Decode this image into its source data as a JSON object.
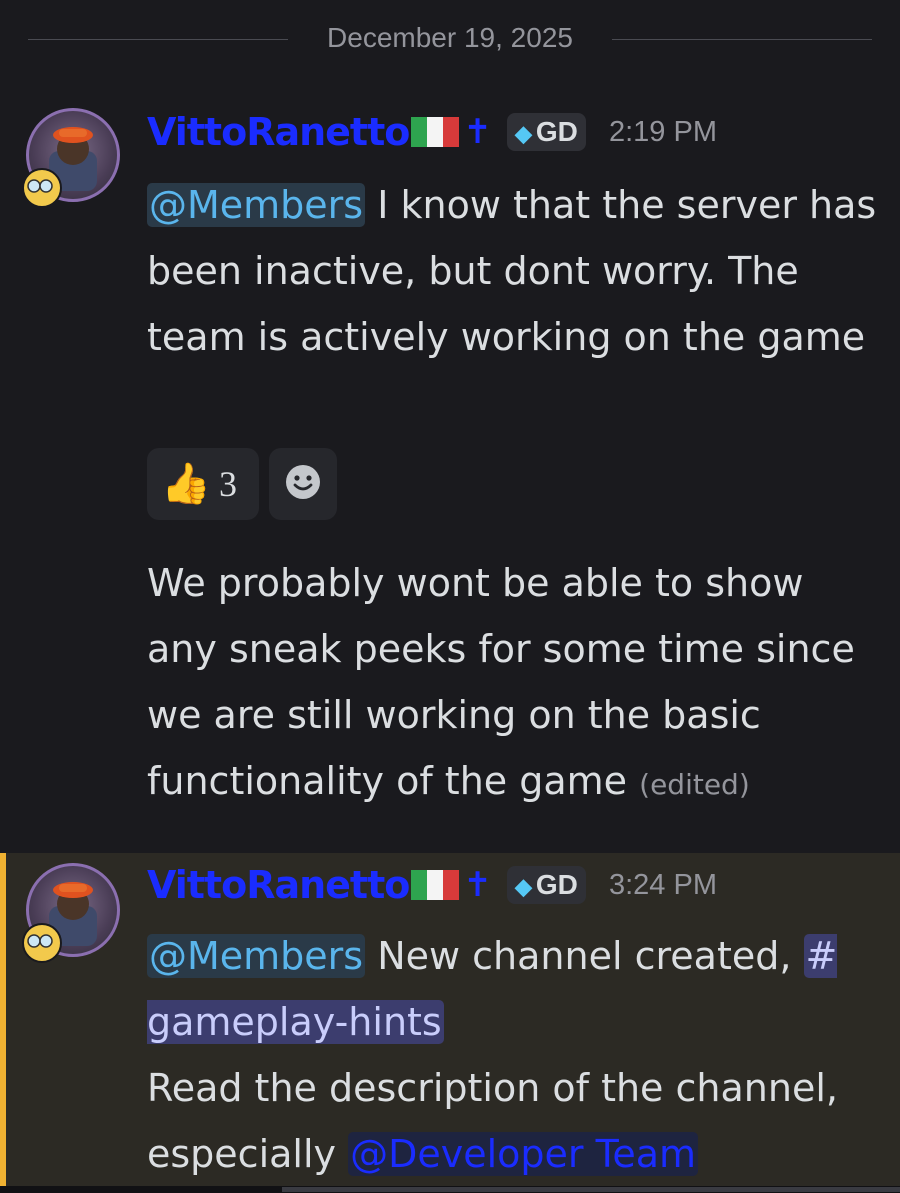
{
  "date_divider": "December 19, 2025",
  "messages": [
    {
      "username": "VittoRanetto",
      "tag": "GD",
      "time": "2:19 PM",
      "part1": {
        "mention": "@Members",
        "text": " I know that the server has been inactive, but dont worry. The team is actively working on the game"
      },
      "reactions": [
        {
          "emoji": "thumbs-up",
          "glyph": "👍",
          "count": "3"
        },
        {
          "emoji": "add-reaction"
        }
      ],
      "part2": {
        "text": "We probably wont be able to show any sneak peeks for some time since we are still working on the basic functionality of the game",
        "edited": "(edited)"
      }
    },
    {
      "username": "VittoRanetto",
      "tag": "GD",
      "time": "3:24 PM",
      "mention": "@Members",
      "text_before_channel": " New channel created, ",
      "channel": "#​gameplay-hints",
      "text_after_channel": "Read the description of the channel, especially ",
      "role_mention": "@Developer Team",
      "highlighted": true
    }
  ],
  "colors": {
    "background": "#1a1a1e",
    "highlight_bg": "#2c2a24",
    "highlight_bar": "#f0b232",
    "username": "#1a2cff",
    "mention": "#5ab5ec"
  }
}
